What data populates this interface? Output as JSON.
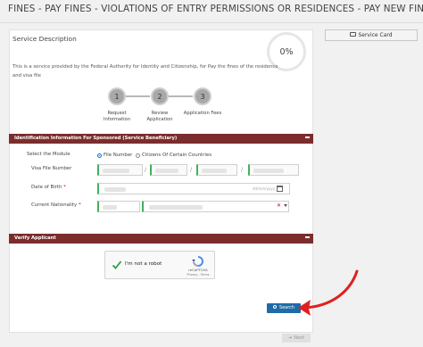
{
  "page_title": "FINES - PAY FINES - VIOLATIONS OF ENTRY PERMISSIONS OR RESIDENCES - PAY NEW FINE",
  "service": {
    "title": "Service Description",
    "progress": "0%",
    "description": "This is a service provided by the Federal Authority for Identity and Citizenship, for Pay the fines of the residence and visa file"
  },
  "steps": [
    {
      "number": "1",
      "label_line1": "Request",
      "label_line2": "Information"
    },
    {
      "number": "2",
      "label_line1": "Review",
      "label_line2": "Application"
    },
    {
      "number": "3",
      "label_line1": "Application Fees",
      "label_line2": ""
    }
  ],
  "identification": {
    "header": "Identification Information For Sponsored (Service Beneficiary)",
    "module_label": "Select the Module",
    "radio_file_number": "File Number",
    "radio_citizens": "Citizens Of Certain Countries",
    "visa_file_label": "Visa File Number",
    "dob_label": "Date of Birth",
    "dob_placeholder": "dd/mm/yyyy",
    "nationality_label": "Current Nationality",
    "required_mark": "*",
    "separator": "/"
  },
  "verify": {
    "header": "Verify Applicant",
    "recaptcha_label": "I'm not a robot",
    "recaptcha_brand": "reCAPTCHA",
    "recaptcha_terms": "Privacy - Terms"
  },
  "buttons": {
    "search": "Search",
    "service_card": "Service Card",
    "next": "Next"
  },
  "colors": {
    "section_header": "#7b2d2d",
    "primary_button": "#1f6ba8",
    "valid_border": "#42b05c",
    "annotation_arrow": "#e02020"
  }
}
